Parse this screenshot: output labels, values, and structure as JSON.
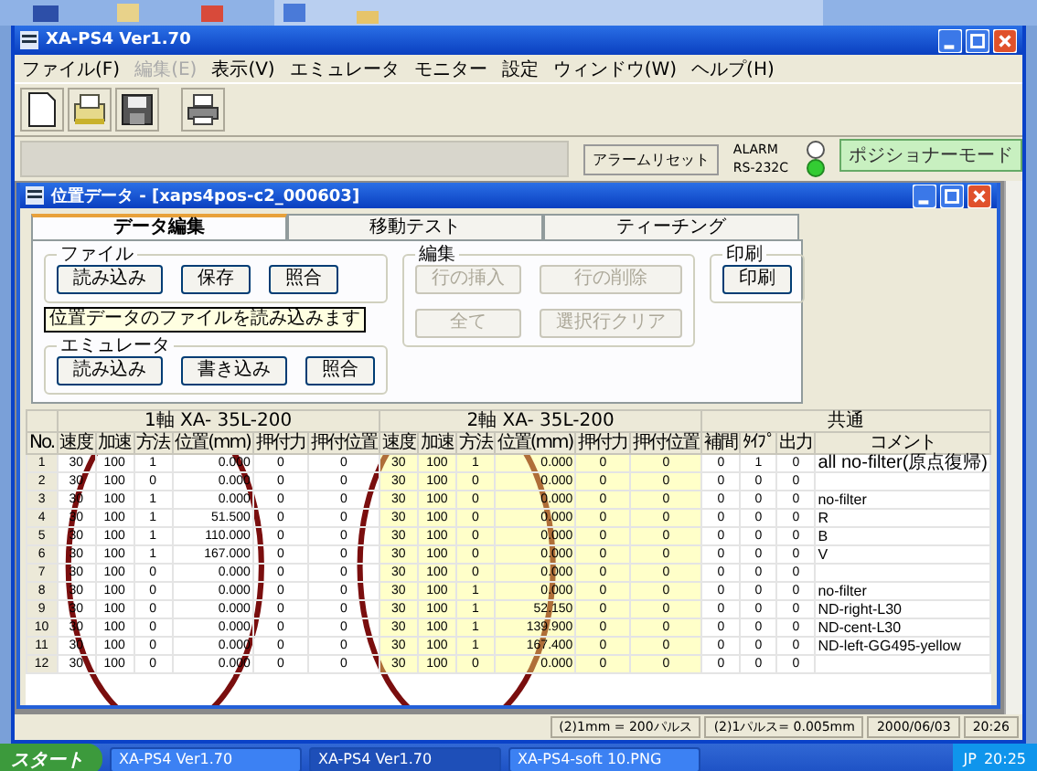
{
  "main_window": {
    "title": "XA-PS4 Ver1.70"
  },
  "menu": [
    {
      "label": "ファイル(F)",
      "disabled": false
    },
    {
      "label": "編集(E)",
      "disabled": true
    },
    {
      "label": "表示(V)",
      "disabled": false
    },
    {
      "label": "エミュレータ",
      "disabled": false
    },
    {
      "label": "モニター",
      "disabled": false
    },
    {
      "label": "設定",
      "disabled": false
    },
    {
      "label": "ウィンドウ(W)",
      "disabled": false
    },
    {
      "label": "ヘルプ(H)",
      "disabled": false
    }
  ],
  "toolbar": [
    {
      "kind": "new"
    },
    {
      "kind": "open"
    },
    {
      "kind": "save"
    },
    {
      "kind": "print"
    }
  ],
  "alarm_reset": "アラームリセット",
  "indicators": [
    {
      "label": "ALARM",
      "on": false
    },
    {
      "label": "RS-232C",
      "on": true
    }
  ],
  "mode": "ポジショナーモード",
  "child_window": {
    "title": "位置データ - [xaps4pos-c2_000603]"
  },
  "tabs": [
    {
      "label": "データ編集",
      "selected": true
    },
    {
      "label": "移動テスト",
      "selected": false
    },
    {
      "label": "ティーチング",
      "selected": false
    }
  ],
  "groups": [
    {
      "title": "ファイル",
      "buttons": [
        {
          "label": "読み込み",
          "disabled": false
        },
        {
          "label": "保存",
          "disabled": false
        },
        {
          "label": "照合",
          "disabled": false
        }
      ]
    },
    {
      "title": "エミュレータ",
      "buttons": [
        {
          "label": "読み込み",
          "disabled": false
        },
        {
          "label": "書き込み",
          "disabled": false
        },
        {
          "label": "照合",
          "disabled": false
        }
      ]
    },
    {
      "title": "編集",
      "buttons": [
        {
          "label": "行の挿入",
          "disabled": true
        },
        {
          "label": "行の削除",
          "disabled": true
        },
        {
          "label": "全て",
          "disabled": true
        },
        {
          "label": "選択行クリア",
          "disabled": true
        }
      ]
    },
    {
      "title": "印刷",
      "buttons": [
        {
          "label": "印刷",
          "disabled": false
        }
      ]
    }
  ],
  "tooltip": "位置データのファイルを読み込みます",
  "table": {
    "group_headers": [
      "1軸 XA- 35L-200",
      "2軸 XA- 35L-200",
      "共通"
    ],
    "columns": [
      "No.",
      "速度",
      "加速",
      "方法",
      "位置(mm)",
      "押付力",
      "押付位置",
      "速度",
      "加速",
      "方法",
      "位置(mm)",
      "押付力",
      "押付位置",
      "補間",
      "ﾀｲﾌﾟ",
      "出力",
      "コメント"
    ],
    "rows": [
      {
        "no": "1",
        "axis1": [
          "30",
          "100",
          "1",
          "0.000",
          "0",
          "0"
        ],
        "axis2": [
          "30",
          "100",
          "1",
          "0.000",
          "0",
          "0"
        ],
        "common": [
          "0",
          "1",
          "0"
        ],
        "comment": "all no-filter(原点復帰)"
      },
      {
        "no": "2",
        "axis1": [
          "30",
          "100",
          "0",
          "0.000",
          "0",
          "0"
        ],
        "axis2": [
          "30",
          "100",
          "0",
          "0.000",
          "0",
          "0"
        ],
        "common": [
          "0",
          "0",
          "0"
        ]
      },
      {
        "no": "3",
        "axis1": [
          "30",
          "100",
          "1",
          "0.000",
          "0",
          "0"
        ],
        "axis2": [
          "30",
          "100",
          "0",
          "0.000",
          "0",
          "0"
        ],
        "common": [
          "0",
          "0",
          "0"
        ],
        "comment": "no-filter"
      },
      {
        "no": "4",
        "axis1": [
          "30",
          "100",
          "1",
          "51.500",
          "0",
          "0"
        ],
        "axis2": [
          "30",
          "100",
          "0",
          "0.000",
          "0",
          "0"
        ],
        "common": [
          "0",
          "0",
          "0"
        ],
        "comment": "R"
      },
      {
        "no": "5",
        "axis1": [
          "30",
          "100",
          "1",
          "110.000",
          "0",
          "0"
        ],
        "axis2": [
          "30",
          "100",
          "0",
          "0.000",
          "0",
          "0"
        ],
        "common": [
          "0",
          "0",
          "0"
        ],
        "comment": "B"
      },
      {
        "no": "6",
        "axis1": [
          "30",
          "100",
          "1",
          "167.000",
          "0",
          "0"
        ],
        "axis2": [
          "30",
          "100",
          "0",
          "0.000",
          "0",
          "0"
        ],
        "common": [
          "0",
          "0",
          "0"
        ],
        "comment": "V"
      },
      {
        "no": "7",
        "axis1": [
          "30",
          "100",
          "0",
          "0.000",
          "0",
          "0"
        ],
        "axis2": [
          "30",
          "100",
          "0",
          "0.000",
          "0",
          "0"
        ],
        "common": [
          "0",
          "0",
          "0"
        ]
      },
      {
        "no": "8",
        "axis1": [
          "30",
          "100",
          "0",
          "0.000",
          "0",
          "0"
        ],
        "axis2": [
          "30",
          "100",
          "1",
          "0.000",
          "0",
          "0"
        ],
        "common": [
          "0",
          "0",
          "0"
        ],
        "comment": "no-filter"
      },
      {
        "no": "9",
        "axis1": [
          "30",
          "100",
          "0",
          "0.000",
          "0",
          "0"
        ],
        "axis2": [
          "30",
          "100",
          "1",
          "52.150",
          "0",
          "0"
        ],
        "common": [
          "0",
          "0",
          "0"
        ],
        "comment": "ND-right-L30"
      },
      {
        "no": "10",
        "axis1": [
          "30",
          "100",
          "0",
          "0.000",
          "0",
          "0"
        ],
        "axis2": [
          "30",
          "100",
          "1",
          "139.900",
          "0",
          "0"
        ],
        "common": [
          "0",
          "0",
          "0"
        ],
        "comment": "ND-cent-L30"
      },
      {
        "no": "11",
        "axis1": [
          "30",
          "100",
          "0",
          "0.000",
          "0",
          "0"
        ],
        "axis2": [
          "30",
          "100",
          "1",
          "167.400",
          "0",
          "0"
        ],
        "common": [
          "0",
          "0",
          "0"
        ],
        "comment": "ND-left-GG495-yellow"
      },
      {
        "no": "12",
        "axis1": [
          "30",
          "100",
          "0",
          "0.000",
          "0",
          "0"
        ],
        "axis2": [
          "30",
          "100",
          "0",
          "0.000",
          "0",
          "0"
        ],
        "common": [
          "0",
          "0",
          "0"
        ]
      }
    ]
  },
  "status_bar": [
    "(2)1mm = 200パルス",
    "(2)1パルス= 0.005mm",
    "2000/06/03",
    "20:26"
  ],
  "taskbar": {
    "start": "スタート",
    "items": [
      {
        "label": "XA-PS4 Ver1.70",
        "selected": false
      },
      {
        "label": "XA-PS4 Ver1.70",
        "selected": true
      },
      {
        "label": "XA-PS4-soft 10.PNG",
        "selected": false
      }
    ],
    "tray_lang": "JP",
    "clock": "20:25"
  }
}
